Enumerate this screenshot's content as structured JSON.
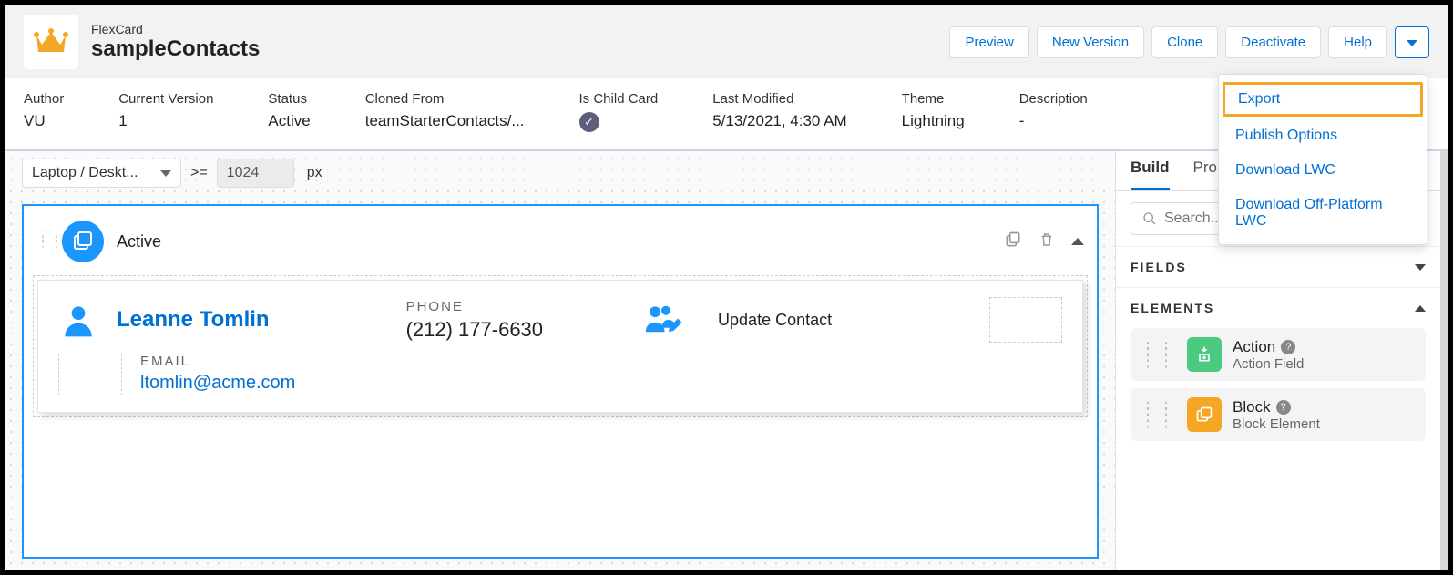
{
  "header": {
    "subtitle": "FlexCard",
    "title": "sampleContacts",
    "buttons": {
      "preview": "Preview",
      "new_version": "New Version",
      "clone": "Clone",
      "deactivate": "Deactivate",
      "help": "Help"
    }
  },
  "dropdown": {
    "export": "Export",
    "publish_options": "Publish Options",
    "download_lwc": "Download LWC",
    "download_off": "Download Off-Platform LWC"
  },
  "meta": {
    "author_label": "Author",
    "author_value": "VU",
    "version_label": "Current Version",
    "version_value": "1",
    "status_label": "Status",
    "status_value": "Active",
    "cloned_label": "Cloned From",
    "cloned_value": "teamStarterContacts/...",
    "child_label": "Is Child Card",
    "modified_label": "Last Modified",
    "modified_value": "5/13/2021, 4:30 AM",
    "theme_label": "Theme",
    "theme_value": "Lightning",
    "desc_label": "Description",
    "desc_value": "-"
  },
  "canvas": {
    "device": "Laptop / Deskt...",
    "operator": ">=",
    "width": "1024",
    "unit": "px",
    "state_label": "Active"
  },
  "card": {
    "name": "Leanne Tomlin",
    "phone_label": "PHONE",
    "phone_value": "(212) 177-6630",
    "update_label": "Update Contact",
    "email_label": "EMAIL",
    "email_value": "ltomlin@acme.com"
  },
  "panel": {
    "tab_build": "Build",
    "tab_props": "Prope",
    "search_placeholder": "Search...",
    "fields_title": "FIELDS",
    "elements_title": "ELEMENTS",
    "elements": {
      "action_title": "Action",
      "action_sub": "Action Field",
      "block_title": "Block",
      "block_sub": "Block Element"
    }
  }
}
